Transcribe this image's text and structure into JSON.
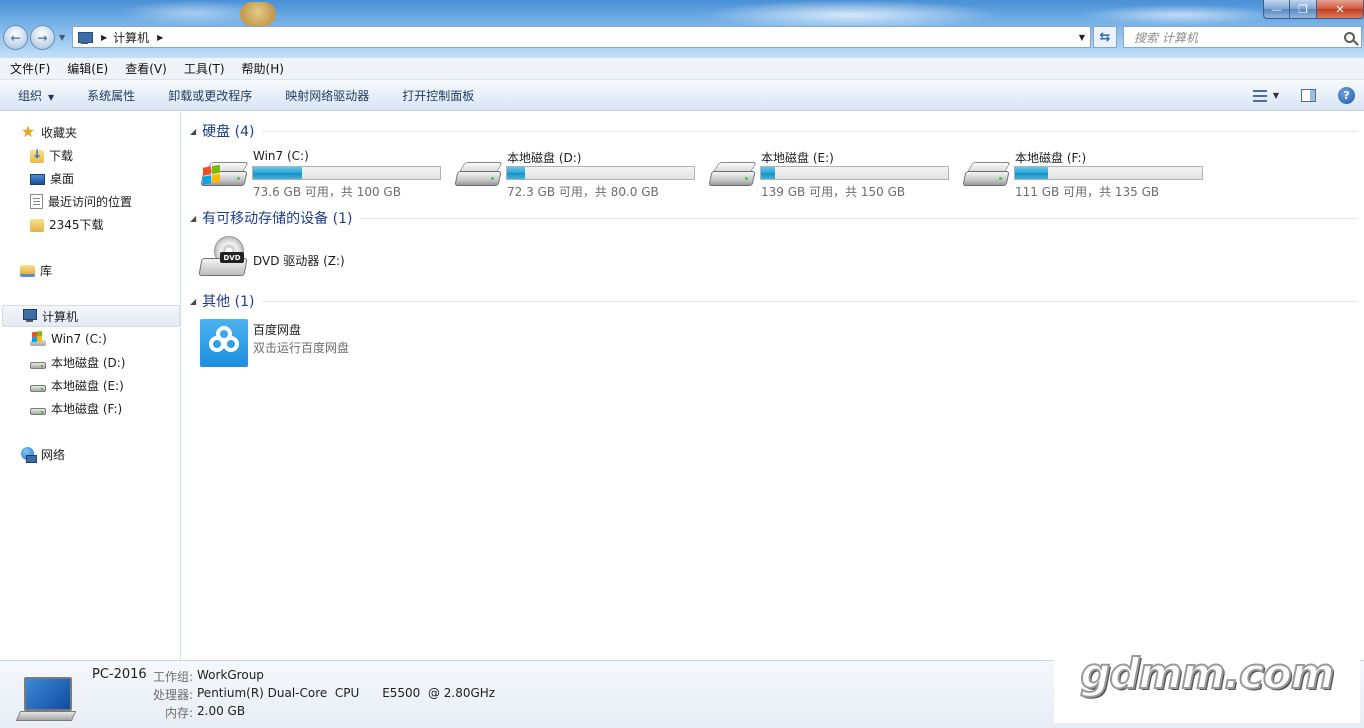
{
  "window": {
    "minimize_glyph": "—",
    "maximize_glyph": "❐",
    "close_glyph": "✕"
  },
  "address": {
    "crumbs": [
      "计算机"
    ],
    "search_placeholder": "搜索 计算机"
  },
  "menu": {
    "items": [
      "文件(F)",
      "编辑(E)",
      "查看(V)",
      "工具(T)",
      "帮助(H)"
    ]
  },
  "commands": {
    "items": [
      "组织",
      "系统属性",
      "卸载或更改程序",
      "映射网络驱动器",
      "打开控制面板"
    ]
  },
  "sidebar": {
    "favorites": {
      "label": "收藏夹",
      "items": [
        "下载",
        "桌面",
        "最近访问的位置",
        "2345下载"
      ]
    },
    "library": {
      "label": "库"
    },
    "computer": {
      "label": "计算机",
      "items": [
        "Win7 (C:)",
        "本地磁盘 (D:)",
        "本地磁盘 (E:)",
        "本地磁盘 (F:)"
      ]
    },
    "network": {
      "label": "网络"
    }
  },
  "groups": {
    "hdd": "硬盘 (4)",
    "removable": "有可移动存储的设备 (1)",
    "other": "其他 (1)"
  },
  "drives": [
    {
      "name": "Win7 (C:)",
      "info": "73.6 GB 可用，共 100 GB",
      "used_fraction": 0.264
    },
    {
      "name": "本地磁盘 (D:)",
      "info": "72.3 GB 可用，共 80.0 GB",
      "used_fraction": 0.096
    },
    {
      "name": "本地磁盘 (E:)",
      "info": "139 GB 可用，共 150 GB",
      "used_fraction": 0.073
    },
    {
      "name": "本地磁盘 (F:)",
      "info": "111 GB 可用，共 135 GB",
      "used_fraction": 0.178
    }
  ],
  "dvd": {
    "name": "DVD 驱动器 (Z:)",
    "badge": "DVD"
  },
  "other": {
    "name": "百度网盘",
    "desc": "双击运行百度网盘"
  },
  "details": {
    "pc_name": "PC-2016",
    "workgroup_label": "工作组:",
    "workgroup": "WorkGroup",
    "cpu_label": "处理器:",
    "cpu": "Pentium(R) Dual-Core  CPU      E5500  @ 2.80GHz",
    "mem_label": "内存:",
    "mem": "2.00 GB"
  },
  "watermark": "gdmm.com"
}
